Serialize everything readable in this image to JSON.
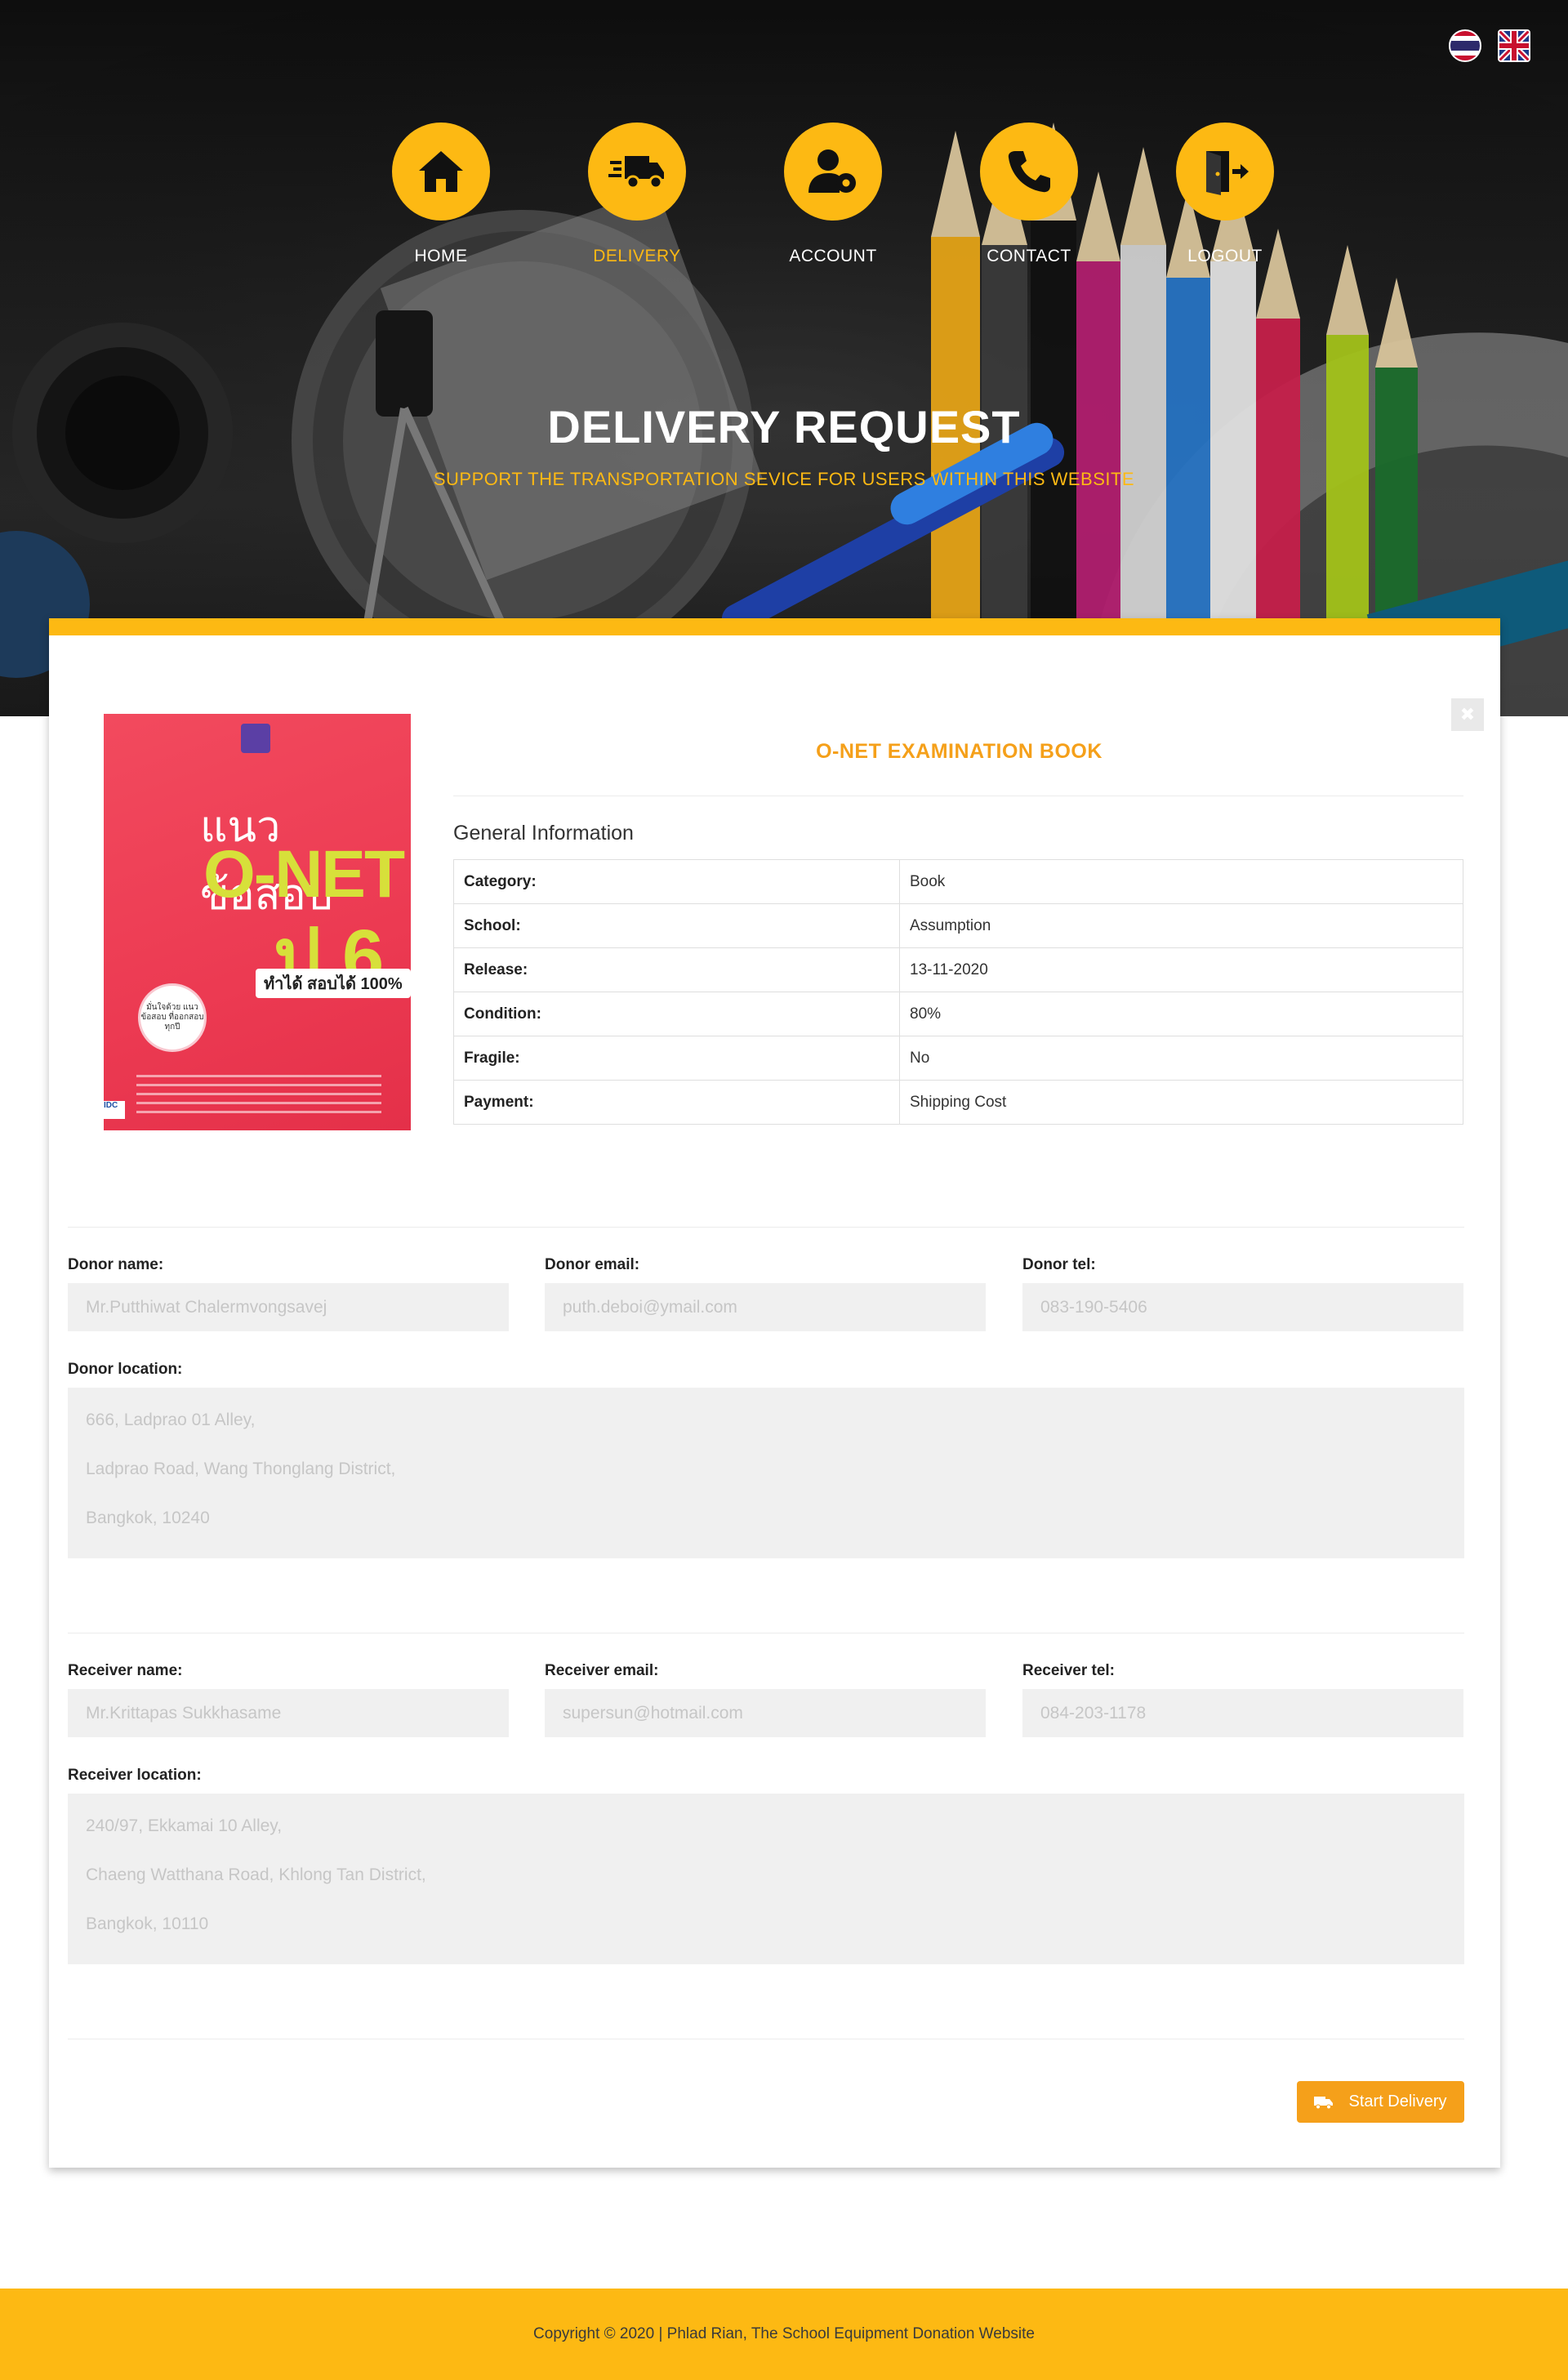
{
  "header": {
    "languages": [
      {
        "code": "th",
        "icon": "thailand-flag-icon"
      },
      {
        "code": "en",
        "icon": "uk-flag-icon"
      }
    ],
    "nav": [
      {
        "label": "HOME",
        "icon": "home-icon",
        "active": false
      },
      {
        "label": "DELIVERY",
        "icon": "delivery-truck-icon",
        "active": true
      },
      {
        "label": "ACCOUNT",
        "icon": "user-gear-icon",
        "active": false
      },
      {
        "label": "CONTACT",
        "icon": "phone-icon",
        "active": false
      },
      {
        "label": "LOGOUT",
        "icon": "logout-door-icon",
        "active": false
      }
    ],
    "title": "DELIVERY REQUEST",
    "subtitle": "SUPPORT THE TRANSPORTATION SEVICE FOR USERS WITHIN THIS WEBSITE"
  },
  "item": {
    "title": "O-NET EXAMINATION BOOK",
    "cover": {
      "thai_title": "แนวข้อสอบ",
      "main": "O-NET",
      "level": "ป.6",
      "tag": "ทำได้ สอบได้ 100%",
      "badge": "มั่นใจด้วย แนวข้อสอบ ที่ออกสอบ ทุกปี",
      "publisher": "IDC"
    },
    "general_info_title": "General Information",
    "info": [
      {
        "key": "Category:",
        "value": "Book"
      },
      {
        "key": "School:",
        "value": "Assumption"
      },
      {
        "key": "Release:",
        "value": "13-11-2020"
      },
      {
        "key": "Condition:",
        "value": "80%"
      },
      {
        "key": "Fragile:",
        "value": "No"
      },
      {
        "key": "Payment:",
        "value": "Shipping Cost"
      }
    ]
  },
  "donor": {
    "name_label": "Donor name:",
    "name_placeholder": "Mr.Putthiwat Chalermvongsavej",
    "email_label": "Donor email:",
    "email_placeholder": "puth.deboi@ymail.com",
    "tel_label": "Donor tel:",
    "tel_placeholder": "083-190-5406",
    "location_label": "Donor location:",
    "location_lines": [
      "666, Ladprao 01 Alley,",
      "Ladprao Road, Wang Thonglang District,",
      "Bangkok, 10240"
    ]
  },
  "receiver": {
    "name_label": "Receiver name:",
    "name_placeholder": "Mr.Krittapas Sukkhasame",
    "email_label": "Receiver email:",
    "email_placeholder": "supersun@hotmail.com",
    "tel_label": "Receiver tel:",
    "tel_placeholder": "084-203-1178",
    "location_label": "Receiver location:",
    "location_lines": [
      "240/97, Ekkamai 10 Alley,",
      "Chaeng Watthana Road, Khlong Tan District,",
      "Bangkok, 10110"
    ]
  },
  "actions": {
    "start_label": "Start Delivery",
    "close_icon": "close-icon"
  },
  "footer": {
    "text": "Copyright © 2020 | Phlad Rian, The School Equipment Donation Website"
  },
  "colors": {
    "accent": "#fdb913",
    "orange": "#f5a01a"
  }
}
